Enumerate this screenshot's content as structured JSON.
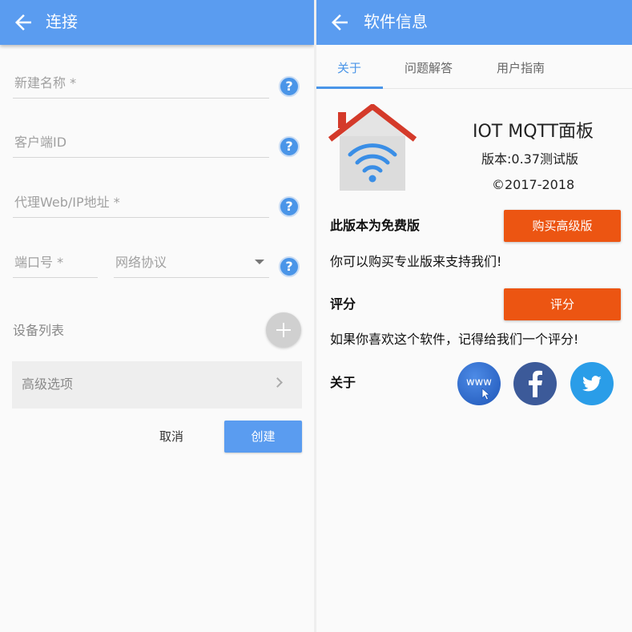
{
  "left": {
    "title": "连接",
    "fields": {
      "name": "新建名称 *",
      "client_id": "客户端ID",
      "broker": "代理Web/IP地址 *",
      "port": "端口号 *",
      "protocol": "网络协议"
    },
    "devices_label": "设备列表",
    "advanced_label": "高级选项",
    "cancel_label": "取消",
    "create_label": "创建"
  },
  "right": {
    "title": "软件信息",
    "tabs": [
      "关于",
      "问题解答",
      "用户指南"
    ],
    "app_name": "IOT MQTT面板",
    "version": "版本:0.37测试版",
    "copyright": "©2017-2018",
    "free_title": "此版本为免费版",
    "buy_label": "购买高级版",
    "support_text": "你可以购买专业版来支持我们!",
    "rate_title": "评分",
    "rate_label": "评分",
    "rate_text": "如果你喜欢这个软件，记得给我们一个评分!",
    "about_title": "关于",
    "social": {
      "www_text": "www"
    }
  },
  "colors": {
    "primary": "#5a9cf0",
    "accent_orange": "#ec5512",
    "help_blue": "#4a95e8"
  },
  "icons": [
    "back-arrow-icon",
    "help-icon",
    "plus-icon",
    "chevron-right-icon",
    "dropdown-arrow-icon",
    "house-wifi-logo",
    "www-icon",
    "facebook-icon",
    "twitter-icon"
  ]
}
